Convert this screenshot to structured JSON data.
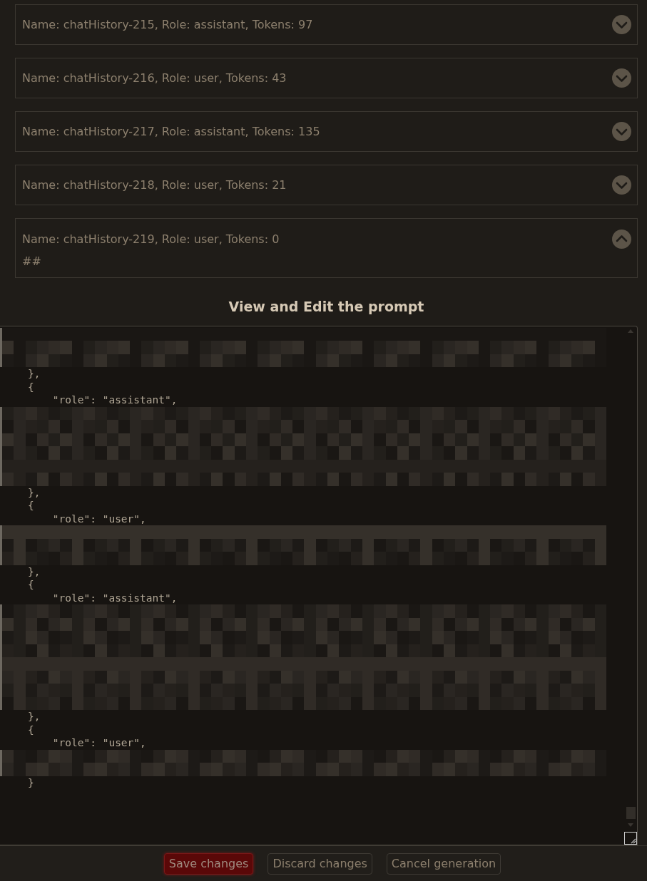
{
  "history": [
    {
      "header": "Name: chatHistory-215, Role: assistant, Tokens: 97",
      "expanded": false
    },
    {
      "header": "Name: chatHistory-216, Role: user, Tokens: 43",
      "expanded": false
    },
    {
      "header": "Name: chatHistory-217, Role: assistant, Tokens: 135",
      "expanded": false
    },
    {
      "header": "Name: chatHistory-218, Role: user, Tokens: 21",
      "expanded": false
    },
    {
      "header": "Name: chatHistory-219, Role: user, Tokens: 0",
      "expanded": true,
      "body": "##"
    }
  ],
  "prompt_title": "View and Edit the prompt",
  "prompt_lines": [
    {
      "kind": "redacted"
    },
    {
      "kind": "redacted"
    },
    {
      "kind": "redacted"
    },
    {
      "kind": "code",
      "text": "    },"
    },
    {
      "kind": "code",
      "text": "    {"
    },
    {
      "kind": "code",
      "text": "        \"role\": \"assistant\","
    },
    {
      "kind": "redacted"
    },
    {
      "kind": "redacted"
    },
    {
      "kind": "redacted"
    },
    {
      "kind": "redacted"
    },
    {
      "kind": "redacted"
    },
    {
      "kind": "redacted"
    },
    {
      "kind": "code",
      "text": "    },"
    },
    {
      "kind": "code",
      "text": "    {"
    },
    {
      "kind": "code",
      "text": "        \"role\": \"user\","
    },
    {
      "kind": "redacted"
    },
    {
      "kind": "redacted"
    },
    {
      "kind": "redacted"
    },
    {
      "kind": "code",
      "text": "    },"
    },
    {
      "kind": "code",
      "text": "    {"
    },
    {
      "kind": "code",
      "text": "        \"role\": \"assistant\","
    },
    {
      "kind": "redacted"
    },
    {
      "kind": "redacted"
    },
    {
      "kind": "redacted"
    },
    {
      "kind": "redacted"
    },
    {
      "kind": "redacted"
    },
    {
      "kind": "redacted"
    },
    {
      "kind": "redacted"
    },
    {
      "kind": "redacted"
    },
    {
      "kind": "code",
      "text": "    },"
    },
    {
      "kind": "code",
      "text": "    {"
    },
    {
      "kind": "code",
      "text": "        \"role\": \"user\","
    },
    {
      "kind": "redacted"
    },
    {
      "kind": "redacted"
    },
    {
      "kind": "code",
      "text": "    }"
    }
  ],
  "buttons": [
    {
      "label": "Save changes",
      "kind": "primary"
    },
    {
      "label": "Discard changes",
      "kind": "secondary"
    },
    {
      "label": "Cancel generation",
      "kind": "secondary"
    }
  ]
}
